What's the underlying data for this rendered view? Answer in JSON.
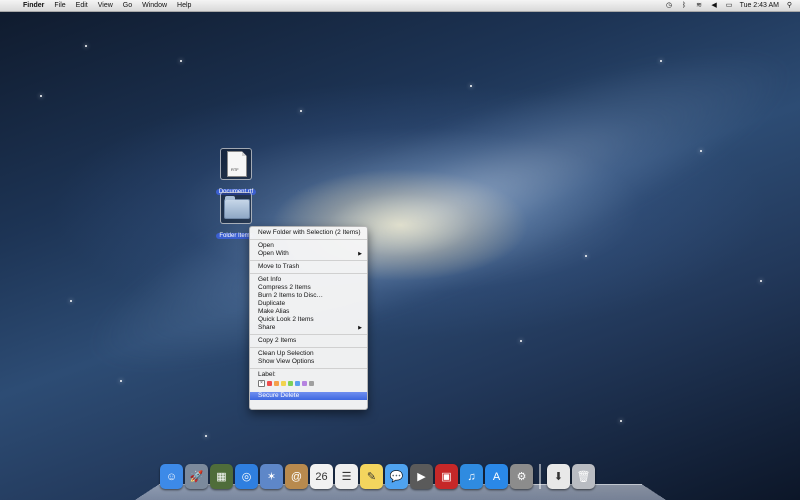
{
  "menubar": {
    "apple": "",
    "app_name": "Finder",
    "menus": [
      "File",
      "Edit",
      "View",
      "Go",
      "Window",
      "Help"
    ],
    "clock": "Tue 2:43 AM"
  },
  "desktop_icons": [
    {
      "label": "Document.rtf",
      "tag": "RTF"
    },
    {
      "label": "Folder Items"
    }
  ],
  "context_menu": {
    "items": [
      {
        "label": "New Folder with Selection (2 Items)"
      },
      {
        "separator": true
      },
      {
        "label": "Open"
      },
      {
        "label": "Open With",
        "submenu": "▶"
      },
      {
        "separator": true
      },
      {
        "label": "Move to Trash"
      },
      {
        "separator": true
      },
      {
        "label": "Get Info"
      },
      {
        "label": "Compress 2 Items"
      },
      {
        "label": "Burn 2 Items to Disc…"
      },
      {
        "label": "Duplicate"
      },
      {
        "label": "Make Alias"
      },
      {
        "label": "Quick Look 2 Items"
      },
      {
        "label": "Share",
        "submenu": "▶"
      },
      {
        "separator": true
      },
      {
        "label": "Copy 2 Items"
      },
      {
        "separator": true
      },
      {
        "label": "Clean Up Selection"
      },
      {
        "label": "Show View Options"
      },
      {
        "separator": true
      }
    ],
    "label_heading": "Label:",
    "label_colors": [
      "#f04c4c",
      "#f5a04a",
      "#f2d34e",
      "#7cd05a",
      "#5aa0f0",
      "#b683e0",
      "#a0a0a0"
    ],
    "highlighted_item": "Secure Delete"
  },
  "dock": {
    "apps": [
      {
        "name": "finder-icon",
        "glyph": "☺",
        "color": "#3d8ae8"
      },
      {
        "name": "launchpad-icon",
        "glyph": "🚀",
        "color": "#7c8a9c"
      },
      {
        "name": "mission-control-icon",
        "glyph": "▦",
        "color": "#4f6d3a"
      },
      {
        "name": "safari-icon",
        "glyph": "◎",
        "color": "#2f7fe0"
      },
      {
        "name": "photo-icon",
        "glyph": "✶",
        "color": "#5e87c8"
      },
      {
        "name": "contacts-icon",
        "glyph": "@",
        "color": "#b88a4e"
      },
      {
        "name": "calendar-icon",
        "glyph": "26",
        "color": "#f2f2f2"
      },
      {
        "name": "reminders-icon",
        "glyph": "☰",
        "color": "#efefef"
      },
      {
        "name": "notes-icon",
        "glyph": "✎",
        "color": "#f3d55e"
      },
      {
        "name": "messages-icon",
        "glyph": "💬",
        "color": "#4fa3f0"
      },
      {
        "name": "facetime-icon",
        "glyph": "▶",
        "color": "#5a5a5a"
      },
      {
        "name": "photo-booth-icon",
        "glyph": "▣",
        "color": "#c62828"
      },
      {
        "name": "itunes-icon",
        "glyph": "♫",
        "color": "#2f8be0"
      },
      {
        "name": "app-store-icon",
        "glyph": "A",
        "color": "#2a88e8"
      },
      {
        "name": "system-preferences-icon",
        "glyph": "⚙",
        "color": "#8c8c8c"
      }
    ],
    "stacks": [
      {
        "name": "downloads-icon",
        "glyph": "⬇",
        "color": "#e8e8e8"
      },
      {
        "name": "trash-icon",
        "glyph": "🗑",
        "color": "#b9bcc2"
      }
    ]
  }
}
